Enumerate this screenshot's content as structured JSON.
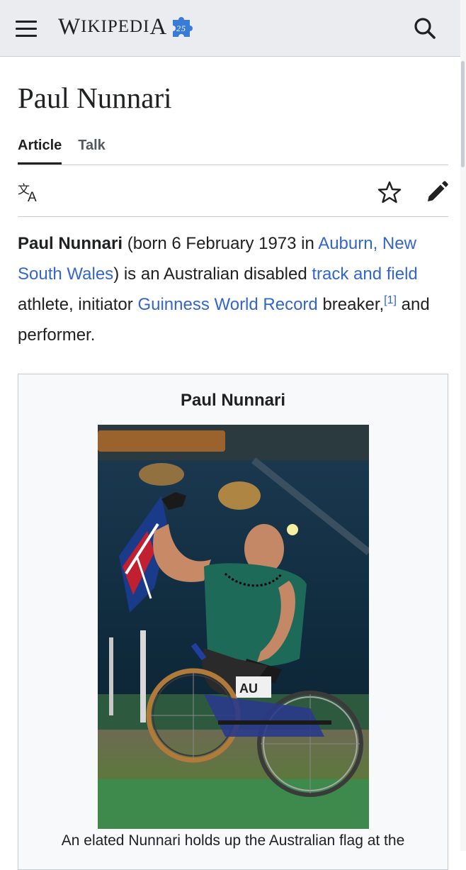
{
  "header": {
    "logo_big_W": "W",
    "logo_small": "IKIPEDI",
    "logo_big_A": "A",
    "logo_badge": "25",
    "menu_icon": "hamburger-menu-icon",
    "search_icon": "search-icon"
  },
  "page": {
    "title": "Paul Nunnari",
    "tabs": [
      {
        "label": "Article",
        "active": true
      },
      {
        "label": "Talk",
        "active": false
      }
    ],
    "actions": {
      "language_icon": "language-icon",
      "watch_icon": "star-icon",
      "edit_icon": "edit-pencil-icon"
    }
  },
  "lead": {
    "subject": "Paul Nunnari",
    "text1": " (born 6 February 1973 in ",
    "link_birthplace": "Auburn, New South Wales",
    "text2": ") is an Australian disabled ",
    "link_sport": "track and field",
    "text3": " athlete, initiator ",
    "link_record": "Guinness World Record",
    "text4": " breaker,",
    "citation": "[1]",
    "text5": " and performer."
  },
  "infobox": {
    "title": "Paul Nunnari",
    "caption": "An elated Nunnari holds up the Australian flag at the"
  },
  "colors": {
    "link": "#3366cc",
    "header_bg": "#eaecf0",
    "text": "#202122",
    "border": "#c8ccd1"
  }
}
